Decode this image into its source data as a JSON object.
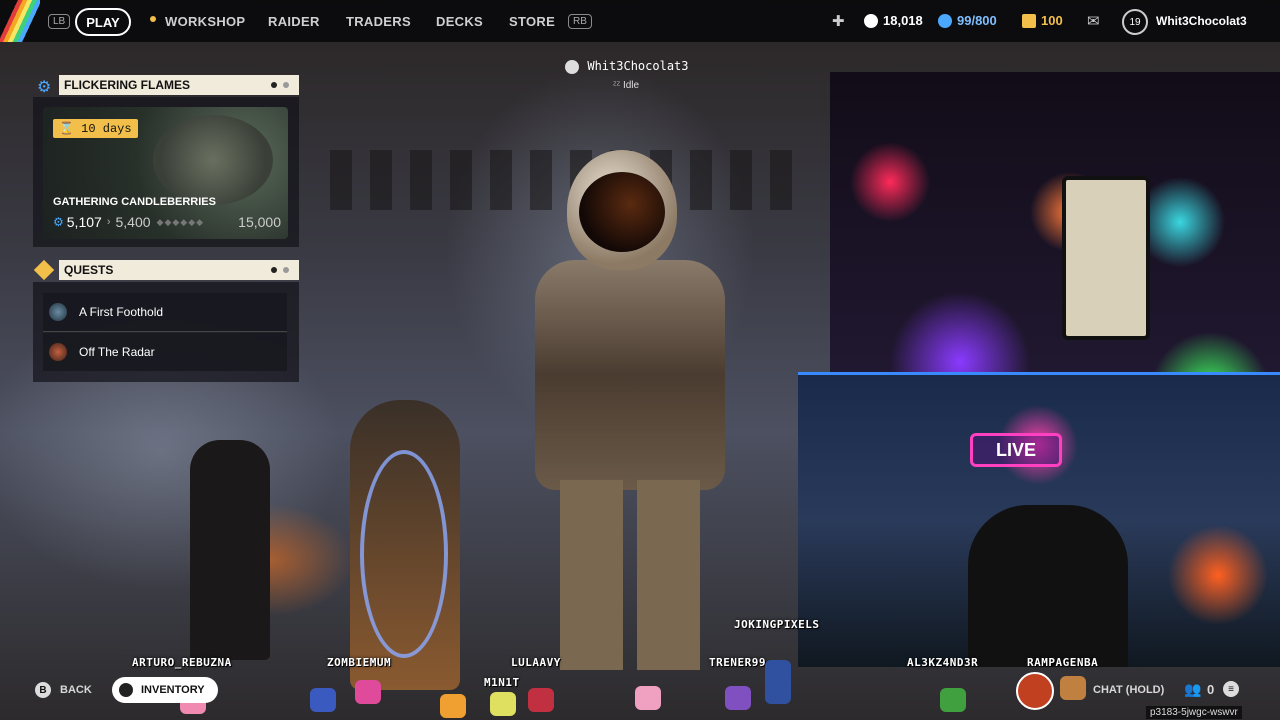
{
  "topbar": {
    "lb": "LB",
    "rb": "RB",
    "nav": {
      "play": "PLAY",
      "workshop": "WORKSHOP",
      "raider": "RAIDER",
      "traders": "TRADERS",
      "decks": "DECKS",
      "store": "STORE"
    },
    "coins": "18,018",
    "tokens": "99/800",
    "raider_tokens": "100",
    "level": "19",
    "username": "Whit3Chocolat3"
  },
  "event": {
    "header": "FLICKERING FLAMES",
    "timer": "10 days",
    "title": "GATHERING CANDLEBERRIES",
    "progress_current": "5,107",
    "progress_next": "5,400",
    "progress_max": "15,000"
  },
  "quests": {
    "header": "QUESTS",
    "items": [
      {
        "label": "A First Foothold"
      },
      {
        "label": "Off The Radar"
      }
    ]
  },
  "presence": {
    "name": "Whit3Chocolat3",
    "status": "Idle"
  },
  "stream": {
    "live_sign": "LIVE"
  },
  "bottom": {
    "back_key": "B",
    "back": "BACK",
    "inventory": "INVENTORY",
    "chat": "CHAT (HOLD)",
    "party_count": "0",
    "stream_id": "p3183-5jwgc-wswvr"
  },
  "viewers": [
    "ARTURO_REBUZNA",
    "ZOMBIEMUM",
    "LULAAVY",
    "M1N1T",
    "TRENER99",
    "JOKINGPIXELS",
    "AL3KZ4ND3R",
    "RAMPAGENBA"
  ],
  "colors": {
    "accent_gold": "#f2c04a",
    "panel_header": "#f1ebdc",
    "topbar": "#0a0a0c"
  }
}
